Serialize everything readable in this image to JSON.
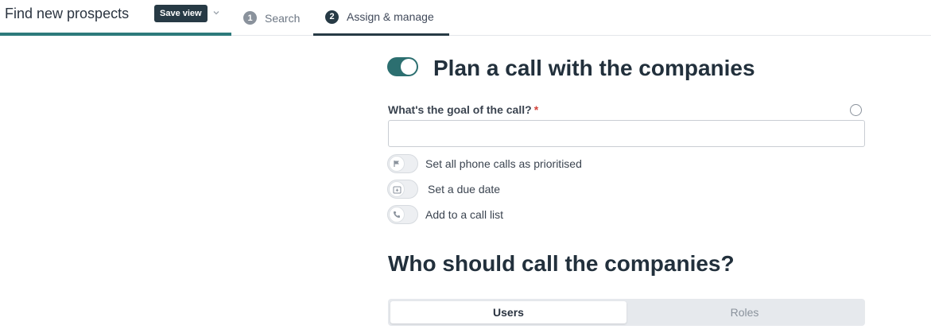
{
  "header": {
    "title": "Find new prospects",
    "save_view_label": "Save view",
    "tabs": [
      {
        "number": "1",
        "label": "Search"
      },
      {
        "number": "2",
        "label": "Assign & manage"
      }
    ]
  },
  "plan": {
    "title": "Plan a call with the companies",
    "enabled": true,
    "goal_label": "What's the goal of the call?",
    "goal_required_mark": "*",
    "goal_value": "",
    "goal_placeholder": "",
    "options": [
      {
        "label": "Set all phone calls as prioritised",
        "icon": "flag-icon",
        "enabled": false
      },
      {
        "label": "Set a due date",
        "icon": "calendar-icon",
        "enabled": false
      },
      {
        "label": "Add to a call list",
        "icon": "phone-icon",
        "enabled": false
      }
    ]
  },
  "who": {
    "title": "Who should call the companies?",
    "segments": [
      "Users",
      "Roles"
    ],
    "selected": "Users"
  },
  "colors": {
    "accent": "#2c7a7b",
    "toggle_on": "#2c6f70",
    "dark": "#273a45",
    "required": "#d2433b"
  }
}
